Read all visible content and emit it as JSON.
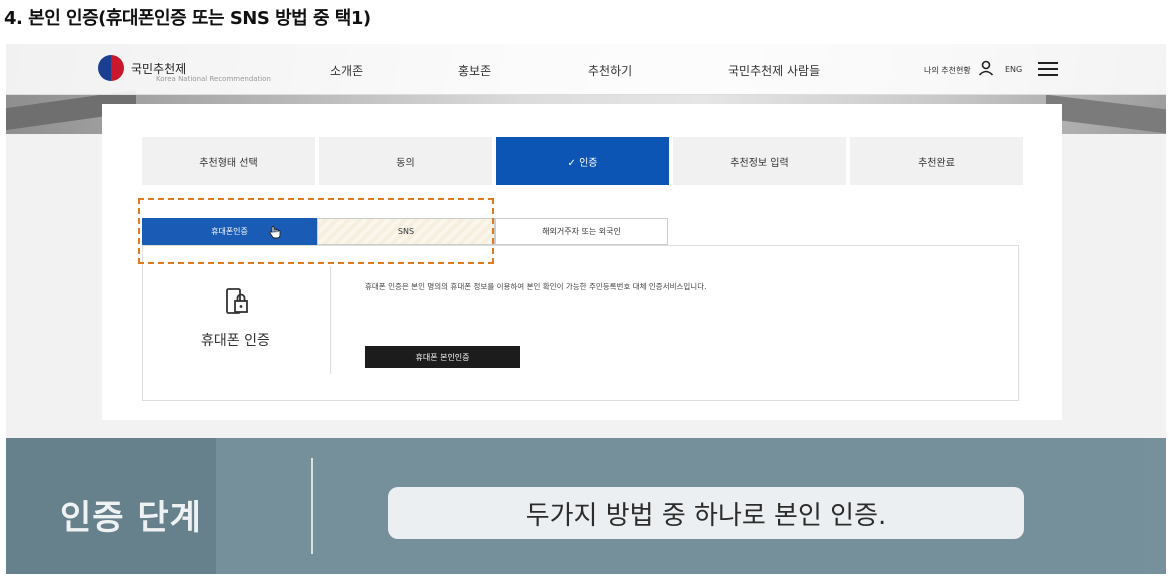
{
  "heading": "4. 본인 인증(휴대폰인증 또는 SNS 방법 중 택1)",
  "nav": {
    "logo_text": "국민추천제",
    "logo_sub": "Korea National Recommendation",
    "items": [
      "소개존",
      "홍보존",
      "추천하기",
      "국민추천제 사람들"
    ],
    "my_status": "나의 추천현황",
    "lang": "ENG",
    "icons": [
      "person-icon",
      "menu-icon"
    ]
  },
  "steps": [
    {
      "label": "추천형태 선택",
      "active": false
    },
    {
      "label": "동의",
      "active": false
    },
    {
      "label": "✓ 인증",
      "active": true
    },
    {
      "label": "추천정보 입력",
      "active": false
    },
    {
      "label": "추천완료",
      "active": false
    }
  ],
  "tabs": [
    {
      "label": "휴대폰인증",
      "selected": true
    },
    {
      "label": "SNS",
      "selected": false
    },
    {
      "label": "해외거주자 또는 외국인",
      "selected": false
    }
  ],
  "panel": {
    "method_label": "휴대폰 인증",
    "description": "휴대폰 인증은 본인 명의의 휴대폰 정보를 이용하여 본인 확인이 가능한 주민등록번호 대체 인증서비스입니다.",
    "button_label": "휴대폰 본인인증"
  },
  "overlay": {
    "title": "인증 단계",
    "caption": "두가지 방법 중 하나로 본인 인증."
  },
  "colors": {
    "accent": "#0d55b5",
    "highlight_dash": "#e07b1e",
    "button_dark": "#1c1c1c",
    "overlay": "#6f8a97"
  }
}
